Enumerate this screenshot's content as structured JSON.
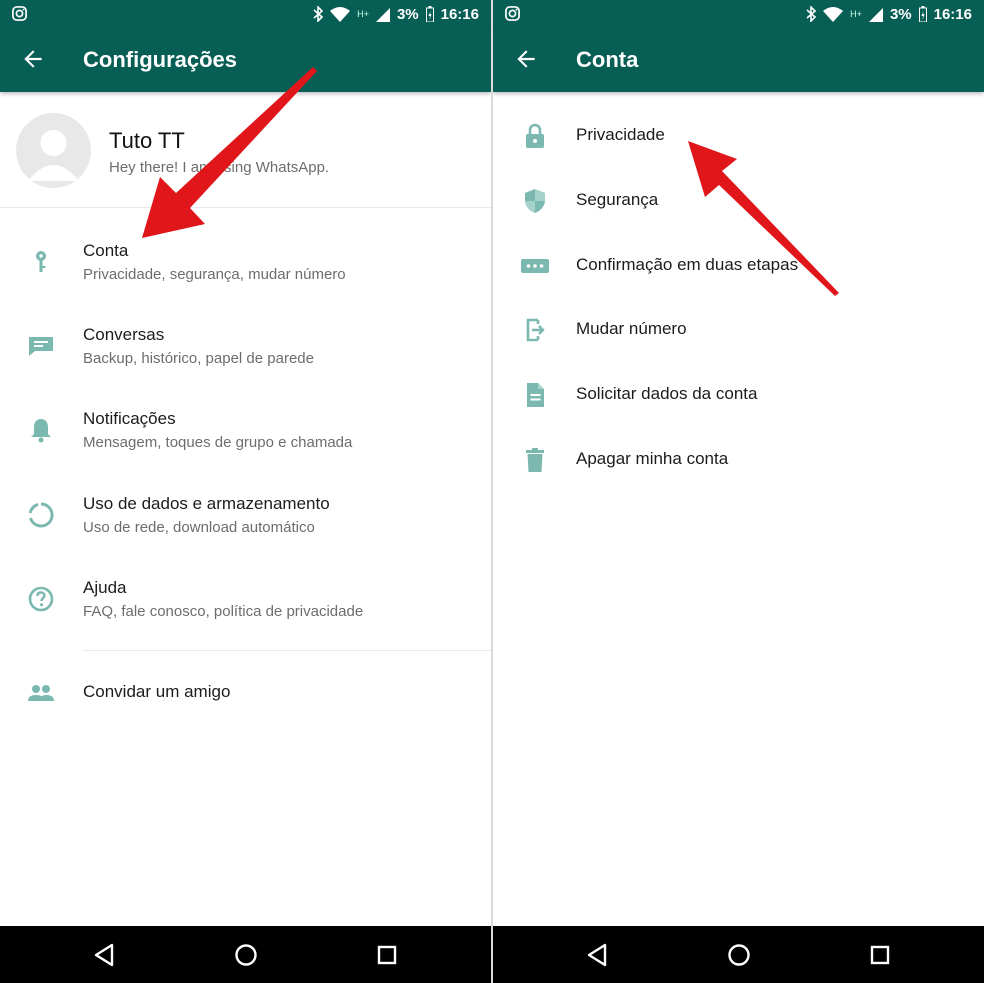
{
  "status_bar": {
    "battery": "3%",
    "time": "16:16",
    "network": "H+"
  },
  "left": {
    "title": "Configurações",
    "profile": {
      "name": "Tuto TT",
      "about": "Hey there! I am using WhatsApp."
    },
    "items": [
      {
        "icon": "key-icon",
        "title": "Conta",
        "subtitle": "Privacidade, segurança, mudar número"
      },
      {
        "icon": "chat-icon",
        "title": "Conversas",
        "subtitle": "Backup, histórico, papel de parede"
      },
      {
        "icon": "bell-icon",
        "title": "Notificações",
        "subtitle": "Mensagem, toques de grupo e chamada"
      },
      {
        "icon": "data-usage-icon",
        "title": "Uso de dados e armazenamento",
        "subtitle": "Uso de rede, download automático"
      },
      {
        "icon": "help-icon",
        "title": "Ajuda",
        "subtitle": "FAQ, fale conosco, política de privacidade"
      }
    ],
    "invite": {
      "icon": "people-icon",
      "title": "Convidar um amigo"
    }
  },
  "right": {
    "title": "Conta",
    "items": [
      {
        "icon": "lock-icon",
        "label": "Privacidade"
      },
      {
        "icon": "shield-icon",
        "label": "Segurança"
      },
      {
        "icon": "dots-icon",
        "label": "Confirmação em duas etapas"
      },
      {
        "icon": "change-number-icon",
        "label": "Mudar número"
      },
      {
        "icon": "document-icon",
        "label": "Solicitar dados da conta"
      },
      {
        "icon": "trash-icon",
        "label": "Apagar minha conta"
      }
    ]
  },
  "colors": {
    "header": "#075e54",
    "icon_teal": "#7ab8b0",
    "annotation_arrow": "#e0161b"
  }
}
